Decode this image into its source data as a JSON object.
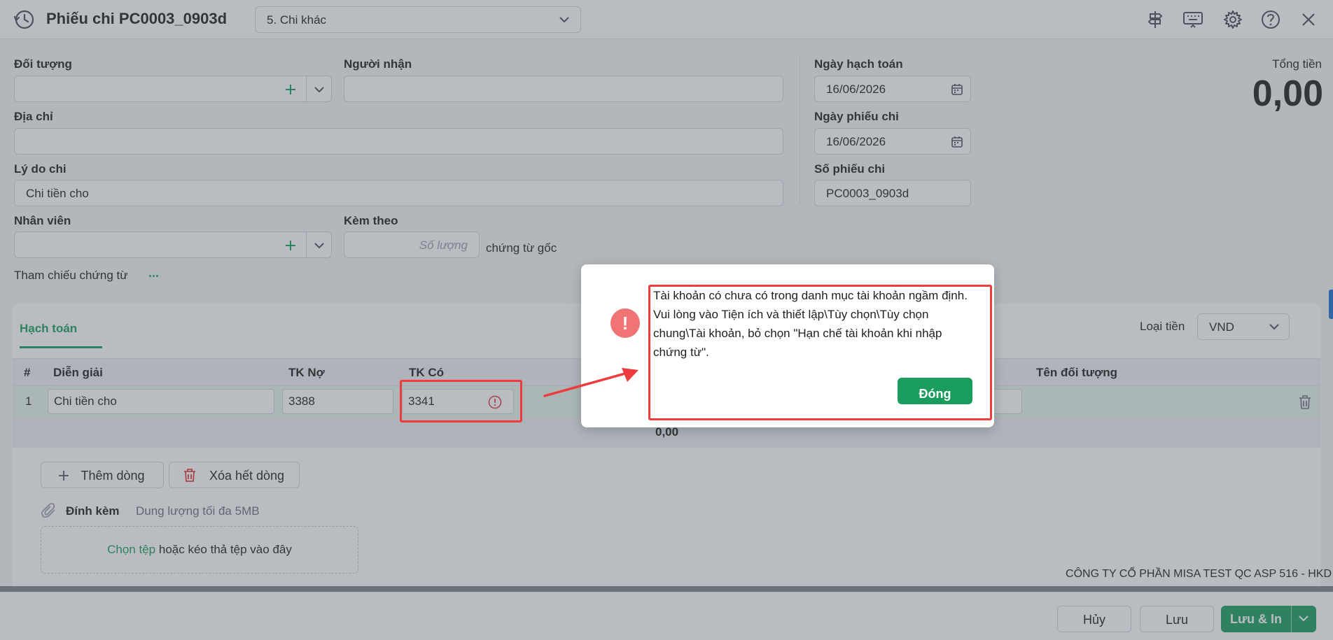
{
  "header": {
    "title": "Phiếu chi PC0003_0903d",
    "type_value": "5. Chi khác"
  },
  "form": {
    "doi_tuong_label": "Đối tượng",
    "doi_tuong_value": "",
    "nguoi_nhan_label": "Người nhận",
    "nguoi_nhan_value": "",
    "dia_chi_label": "Địa chỉ",
    "dia_chi_value": "",
    "ly_do_chi_label": "Lý do chi",
    "ly_do_chi_value": "Chi tiền cho",
    "nhan_vien_label": "Nhân viên",
    "nhan_vien_value": "",
    "kem_theo_label": "Kèm theo",
    "so_luong_placeholder": "Số lượng",
    "chung_tu_goc": "chứng từ gốc",
    "tham_chieu_label": "Tham chiếu chứng từ",
    "tham_chieu_more": "...",
    "ngay_hach_toan_label": "Ngày hạch toán",
    "ngay_hach_toan_value": "16/06/2026",
    "ngay_phieu_chi_label": "Ngày phiếu chi",
    "ngay_phieu_chi_value": "16/06/2026",
    "so_phieu_chi_label": "Số phiếu chi",
    "so_phieu_chi_value": "PC0003_0903d",
    "tong_tien_label": "Tổng tiền",
    "tong_tien_value": "0,00"
  },
  "grid": {
    "tab_label": "Hạch toán",
    "currency_label": "Loại tiền",
    "currency_value": "VND",
    "columns": [
      "#",
      "Diễn giải",
      "TK Nợ",
      "TK Có",
      "Tên đối tượng"
    ],
    "rows": [
      {
        "index": "1",
        "dien_giai": "Chi tiền cho",
        "tk_no": "3388",
        "tk_co": "3341"
      }
    ],
    "sum_value": "0,00",
    "add_row_label": "Thêm dòng",
    "delete_all_label": "Xóa hết dòng",
    "attach_label": "Đính kèm",
    "attach_hint": "Dung lượng tối đa 5MB",
    "dropzone_link": "Chọn tệp",
    "dropzone_text": "hoặc kéo thả tệp vào đây"
  },
  "company": "CÔNG TY CỔ PHẦN MISA TEST QC ASP 516 - HKD",
  "footer": {
    "cancel_label": "Hủy",
    "save_label": "Lưu",
    "save_print_label": "Lưu & In"
  },
  "modal": {
    "icon_glyph": "!",
    "message": "Tài khoản có chưa có trong danh mục tài khoản ngầm định. Vui lòng vào Tiện ích và thiết lập\\Tùy chọn\\Tùy chọn chung\\Tài khoản, bỏ chọn \"Hạn chế tài khoản khi nhập chứng từ\".",
    "close_label": "Đóng"
  },
  "colors": {
    "accent": "#1a9d5c",
    "error": "#f07474",
    "annotation": "#ee3b3b"
  }
}
